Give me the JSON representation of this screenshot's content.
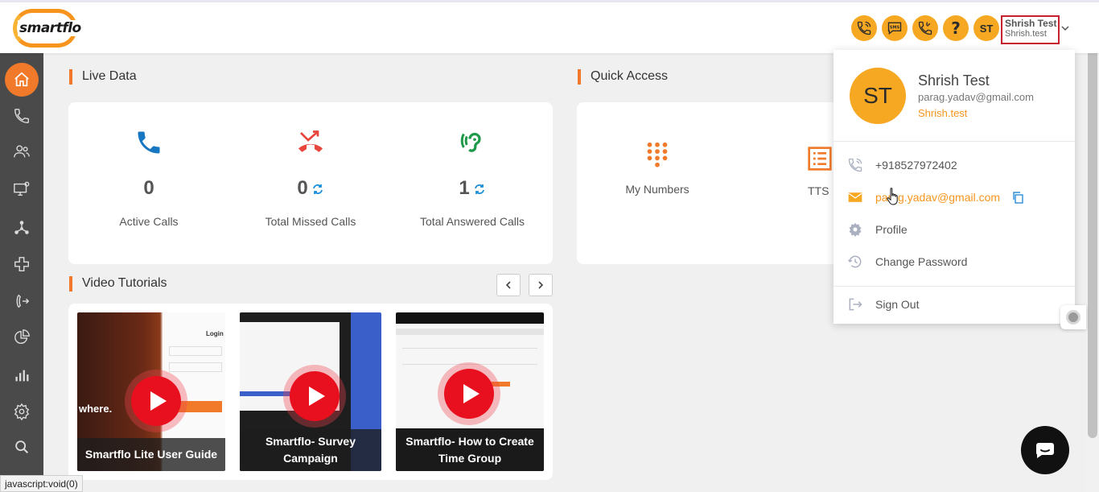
{
  "header": {
    "logo_text": "smartflo",
    "help_label": "?",
    "avatar_initials": "ST",
    "user_name": "Shrish Test",
    "user_handle": "Shrish.test",
    "accent_color": "#f7a823"
  },
  "sidebar": {
    "items": [
      {
        "icon": "home-icon",
        "active": true
      },
      {
        "icon": "phone-icon"
      },
      {
        "icon": "users-icon"
      },
      {
        "icon": "monitor-settings-icon"
      },
      {
        "icon": "network-icon"
      },
      {
        "icon": "integration-icon"
      },
      {
        "icon": "call-transfer-icon"
      },
      {
        "icon": "pie-chart-icon"
      },
      {
        "icon": "bar-chart-icon"
      },
      {
        "icon": "gear-icon"
      },
      {
        "icon": "search-icon"
      }
    ]
  },
  "live_data": {
    "title": "Live Data",
    "stats": [
      {
        "value": "0",
        "label": "Active Calls"
      },
      {
        "value": "0",
        "label": "Total Missed Calls"
      },
      {
        "value": "1",
        "label": "Total Answered Calls"
      }
    ]
  },
  "quick_access": {
    "title": "Quick Access",
    "items": [
      {
        "label": "My Numbers"
      },
      {
        "label": "TTS"
      }
    ]
  },
  "video_tutorials": {
    "title": "Video Tutorials",
    "videos": [
      {
        "caption": "Smartflo Lite User Guide",
        "thumb_text_1": "Login",
        "thumb_text_2": "where."
      },
      {
        "caption": "Smartflo- Survey Campaign"
      },
      {
        "caption": "Smartflo- How to Create Time Group"
      }
    ]
  },
  "profile_menu": {
    "avatar_initials": "ST",
    "name": "Shrish Test",
    "email": "parag.yadav@gmail.com",
    "username": "Shrish.test",
    "phone": "+918527972402",
    "contact_email": "parag.yadav@gmail.com",
    "profile_label": "Profile",
    "change_password_label": "Change Password",
    "sign_out_label": "Sign Out"
  },
  "status_bar": {
    "text": "javascript:void(0)"
  }
}
